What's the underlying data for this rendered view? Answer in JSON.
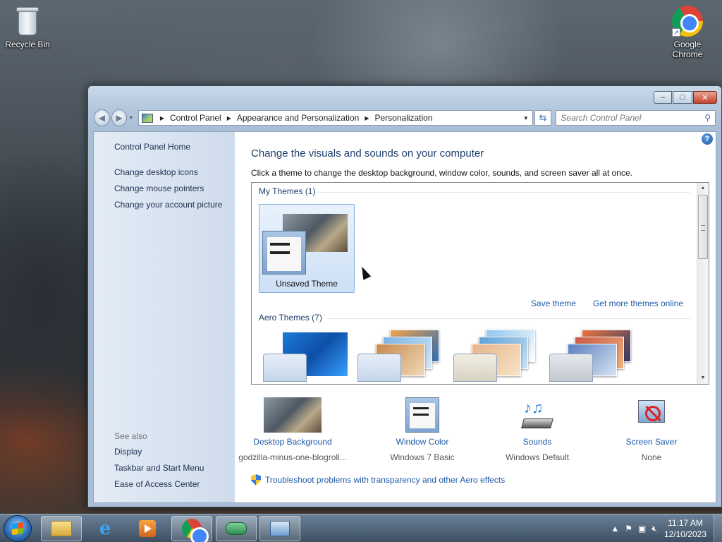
{
  "desktop": {
    "icons": [
      {
        "label": "Recycle Bin",
        "icon": "recycle-bin-icon"
      },
      {
        "label": "Google Chrome",
        "icon": "chrome-icon"
      }
    ]
  },
  "window": {
    "controls": {
      "minimize": "–",
      "maximize": "□",
      "close": "✕"
    },
    "address": {
      "crumbs": [
        "Control Panel",
        "Appearance and Personalization",
        "Personalization"
      ]
    },
    "search": {
      "placeholder": "Search Control Panel"
    }
  },
  "leftpane": {
    "home": "Control Panel Home",
    "links": [
      "Change desktop icons",
      "Change mouse pointers",
      "Change your account picture"
    ],
    "see_also_title": "See also",
    "see_also": [
      "Display",
      "Taskbar and Start Menu",
      "Ease of Access Center"
    ]
  },
  "main": {
    "heading": "Change the visuals and sounds on your computer",
    "subheading": "Click a theme to change the desktop background, window color, sounds, and screen saver all at once.",
    "my_themes_title": "My Themes (1)",
    "my_theme_name": "Unsaved Theme",
    "save_theme": "Save theme",
    "get_more": "Get more themes online",
    "aero_title": "Aero Themes (7)",
    "bottom": [
      {
        "link": "Desktop Background",
        "sub": "godzilla-minus-one-blogroll..."
      },
      {
        "link": "Window Color",
        "sub": "Windows 7 Basic"
      },
      {
        "link": "Sounds",
        "sub": "Windows Default"
      },
      {
        "link": "Screen Saver",
        "sub": "None"
      }
    ],
    "troubleshoot": "Troubleshoot problems with transparency and other Aero effects"
  },
  "taskbar": {
    "time": "11:17 AM",
    "date": "12/10/2023"
  }
}
